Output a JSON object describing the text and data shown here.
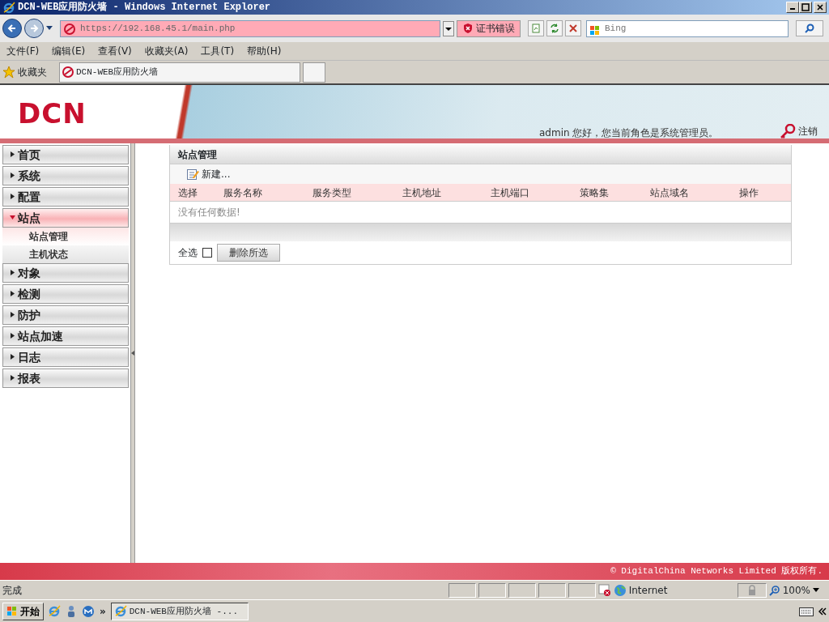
{
  "window": {
    "title": "DCN-WEB应用防火墙 - Windows Internet Explorer"
  },
  "browser": {
    "address": "https://192.168.45.1/main.php",
    "cert_error": "证书错误",
    "search_placeholder": "Bing",
    "menu": [
      "文件(F)",
      "编辑(E)",
      "查看(V)",
      "收藏夹(A)",
      "工具(T)",
      "帮助(H)"
    ],
    "favorites_label": "收藏夹",
    "tab_title": "DCN-WEB应用防火墙"
  },
  "banner": {
    "logo": "DCN",
    "greeting": "admin 您好，您当前角色是系统管理员。",
    "logout": "注销"
  },
  "sidebar": {
    "items": [
      {
        "label": "首页",
        "expanded": false
      },
      {
        "label": "系统",
        "expanded": false
      },
      {
        "label": "配置",
        "expanded": false
      },
      {
        "label": "站点",
        "expanded": true,
        "children": [
          {
            "label": "站点管理",
            "selected": true
          },
          {
            "label": "主机状态",
            "selected": false
          }
        ]
      },
      {
        "label": "对象",
        "expanded": false
      },
      {
        "label": "检测",
        "expanded": false
      },
      {
        "label": "防护",
        "expanded": false
      },
      {
        "label": "站点加速",
        "expanded": false
      },
      {
        "label": "日志",
        "expanded": false
      },
      {
        "label": "报表",
        "expanded": false
      }
    ]
  },
  "panel": {
    "title": "站点管理",
    "new_button": "新建...",
    "columns": [
      "选择",
      "服务名称",
      "服务类型",
      "主机地址",
      "主机端口",
      "策略集",
      "站点域名",
      "操作"
    ],
    "empty_message": "没有任何数据!",
    "select_all": {
      "label": "全选",
      "checked": false
    },
    "delete_button": "删除所选"
  },
  "footer": {
    "copyright": "© DigitalChina Networks Limited 版权所有."
  },
  "status_bar": {
    "text": "完成",
    "zone": "Internet",
    "zoom": "100%"
  },
  "taskbar": {
    "start": "开始",
    "more": "»",
    "task": "DCN-WEB应用防火墙 -..."
  }
}
